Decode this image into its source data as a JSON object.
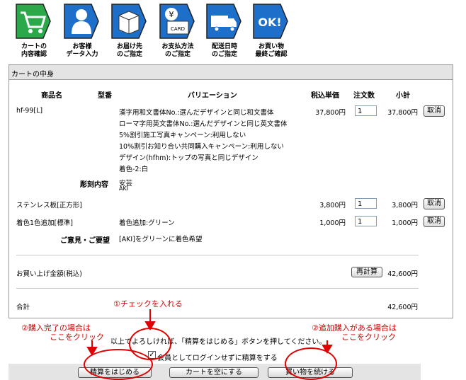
{
  "steps": [
    {
      "label": "カートの\n内容確認",
      "icon": "cart-icon",
      "color": "#2aa84a"
    },
    {
      "label": "お客様\nデータ入力",
      "icon": "person-icon",
      "color": "#1e6fc9"
    },
    {
      "label": "お届け先\nのご指定",
      "icon": "box-icon",
      "color": "#1e6fc9"
    },
    {
      "label": "お支払方法\nのご指定",
      "icon": "card-icon",
      "color": "#1e6fc9"
    },
    {
      "label": "配送日時\nのご指定",
      "icon": "truck-icon",
      "color": "#1e6fc9"
    },
    {
      "label": "お買い物\n最終ご確認",
      "icon": "ok-icon",
      "color": "#1e6fc9"
    }
  ],
  "step_icon_text": {
    "card_yen": "¥",
    "card": "CARD",
    "ok": "OK!"
  },
  "cart": {
    "title": "カートの中身",
    "headers": {
      "product": "商品名",
      "model": "型番",
      "variation": "バリエーション",
      "price": "税込単価",
      "qty": "注文数",
      "subtotal": "小計"
    },
    "item1": {
      "name": "hf-99[L]",
      "variations": [
        "漢字用和文書体No.:選んだデザインと同じ和文書体",
        "ローマ字用英文書体No.:選んだデザインと同じ英文書体",
        "5%割引施工写真キャンペーン:利用しない",
        "10%割引お知り合い共同購入キャンペーン:利用しない",
        "デザイン(hfhm):トップの写真と同じデザイン",
        "着色-2:白"
      ],
      "price": "37,800円",
      "qty": "1",
      "subtotal": "37,800円"
    },
    "engraving_label": "彫刻内容",
    "engraving_lines": [
      "安芸",
      "AKI"
    ],
    "item2": {
      "name": "ステンレス板[正方形]",
      "price": "3,800円",
      "qty": "1",
      "subtotal": "3,800円"
    },
    "item3": {
      "name": "着色1色追加[標準]",
      "variation": "着色追加:グリーン",
      "price": "1,000円",
      "qty": "1",
      "subtotal": "1,000円"
    },
    "remove_label": "取消",
    "comment_label": "ご意見・ご要望",
    "comment_value": "[AKI]をグリーンに着色希望",
    "purchase_total_label": "お買い上げ金額(税込)",
    "recalc_label": "再計算",
    "purchase_total": "42,600円",
    "total_label": "合計",
    "total": "42,600円"
  },
  "instruction": "以上でよろしければ、「精算をはじめる」ボタンを押してください。",
  "checkbox_label": "会員としてログインせずに精算をする",
  "buttons": {
    "checkout": "精算をはじめる",
    "empty": "カートを空にする",
    "continue": "買い物を続ける"
  },
  "annotations": {
    "check": "①チェックを入れる",
    "complete_line1": "②購入完了の場合は",
    "complete_line2": "ここをクリック",
    "more_line1": "②追加購入がある場合は",
    "more_line2": "ここをクリック"
  },
  "annotation_color": "#e00000"
}
